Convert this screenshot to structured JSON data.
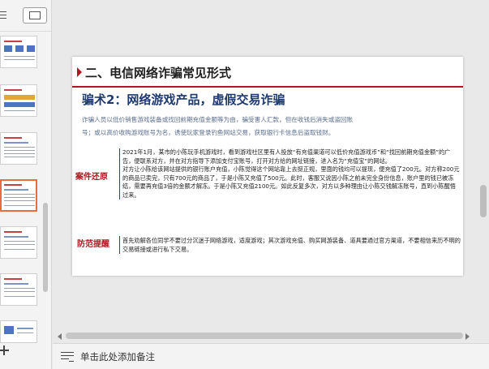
{
  "slide": {
    "header": "二、电信网络诈骗常见形式",
    "subtitle": "骗术2：网络游戏产品，虚假交易诈骗",
    "intro_line1": "诈骗人员以低价销售游戏装备或找回前期充值金额等为由，骗受害人汇款，但在收钱后消失或盗回账",
    "intro_line2": "号；或以高价收购游戏账号为名，诱使玩家登录钓鱼网站交易，获取银行卡信息后盗取钱财。",
    "case_label": "案件还原",
    "case_p1": "2021年1月，某市的小陈玩手机游戏时，看到游戏社区里有人投放“有充值渠道可以低价充值游戏币”和“找回前期充值金额”的广告，便联系对方，并在对方指导下添加支付宝账号，打开对方给的网址链接，进入名为“充值宝”的网站。",
    "case_p2": "对方让小陈给该网站提供的银行账户充值，小陈觉得这个网站靠上去挺正规，里面的钱均可以提现，便充值了200元。对方称200元的商品已卖完，只有700元的商品了，于是小陈又充值了500元。此时，客服又说因小陈之前未完全身份信息，账户里的钱已被冻结，需要再充值3倍的金额才解冻。于是小陈又充值2100元。如此反复多次，对方以多种理由让小陈交钱解冻账号，直到小陈醒悟过来。",
    "tip_label": "防范提醒",
    "tip_text": "首先劝解各位同学不要过分沉迷于网络游戏，适度游戏；其次游戏充值、购买网游装备、道具要通过官方渠道，不要相信来历不明的交易链接或进行私下交易。"
  },
  "notes": {
    "placeholder": "单击此处添加备注"
  },
  "icons": {
    "list_view": "list-icon",
    "view_toggle": "slide-view-icon",
    "add_slide": "plus-icon",
    "notes": "notes-icon"
  },
  "colors": {
    "accent_red": "#b0161f",
    "subtitle_blue": "#1f3a6e",
    "active_thumb_border": "#e86c3c"
  }
}
